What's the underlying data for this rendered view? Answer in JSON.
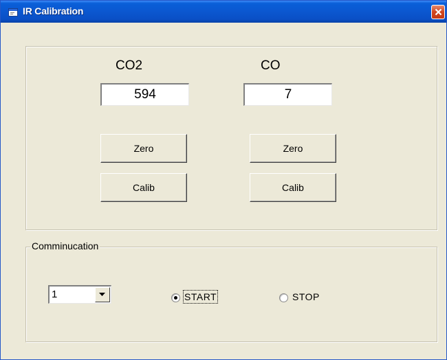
{
  "window": {
    "title": "IR Calibration"
  },
  "calibration": {
    "co2": {
      "label": "CO2",
      "value": "594",
      "zero_label": "Zero",
      "calib_label": "Calib"
    },
    "co": {
      "label": "CO",
      "value": "7",
      "zero_label": "Zero",
      "calib_label": "Calib"
    }
  },
  "communication": {
    "group_label": "Comminucation",
    "port_value": "1",
    "start_label": "START",
    "stop_label": "STOP",
    "selected": "START"
  },
  "colors": {
    "titlebar": "#0b57d0",
    "close_button": "#d0451e",
    "window_background": "#ece9d8"
  },
  "icons": {
    "title": "window-icon",
    "close": "close-icon",
    "dropdown": "chevron-down-icon"
  }
}
